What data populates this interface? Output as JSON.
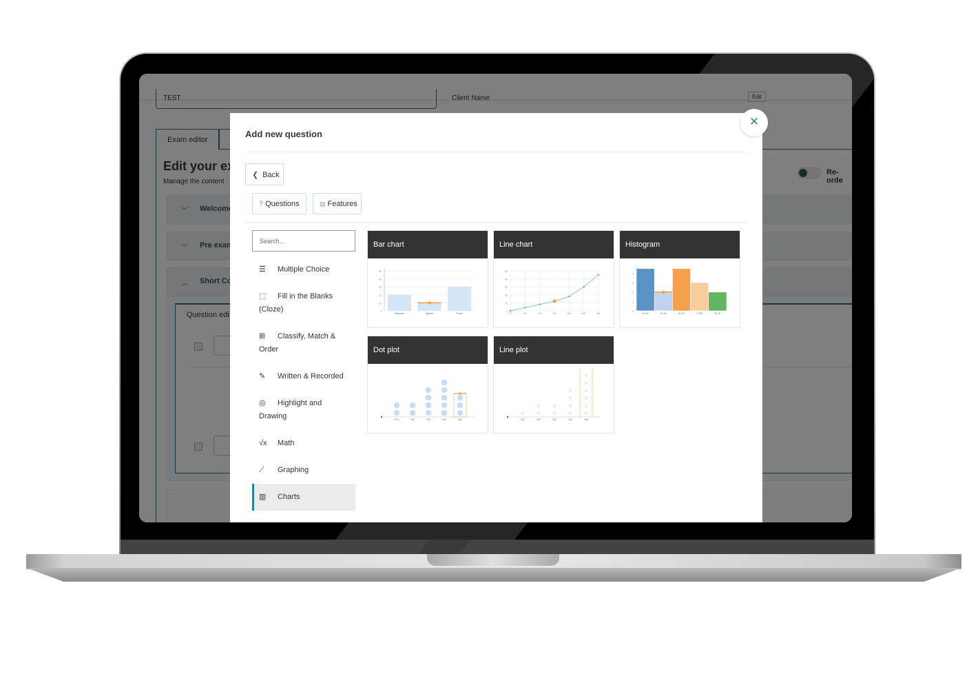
{
  "background_page": {
    "field_value": "TEST",
    "client_label": "Client Name",
    "edit_label": "Edit",
    "tab": "Exam editor",
    "heading": "Edit your ex",
    "subheading": "Manage the content",
    "sections": [
      {
        "chevron": "﹀",
        "label": "Welcome"
      },
      {
        "chevron": "﹀",
        "label": "Pre exam"
      },
      {
        "chevron": "︿",
        "label": "Short Co"
      }
    ],
    "question_editor_label": "Question edi",
    "reorder_label": "Re-orde"
  },
  "modal": {
    "title": "Add new question",
    "close_icon": "✕",
    "back_label": "Back",
    "tabs": [
      {
        "icon": "?",
        "label": "Questions"
      },
      {
        "icon": "🖼",
        "label": "Features"
      }
    ],
    "search_placeholder": "Search...",
    "categories": [
      {
        "icon": "list-icon",
        "glyph": "☰",
        "label": "Multiple Choice",
        "active": false
      },
      {
        "icon": "dotted-box-icon",
        "glyph": "⬚",
        "label": "Fill in the Blanks (Cloze)",
        "active": false
      },
      {
        "icon": "grid-icon",
        "glyph": "⊞",
        "label": "Classify, Match & Order",
        "active": false
      },
      {
        "icon": "pencil-icon",
        "glyph": "✎",
        "label": "Written & Recorded",
        "active": false
      },
      {
        "icon": "target-icon",
        "glyph": "◎",
        "label": "Highlight and Drawing",
        "active": false
      },
      {
        "icon": "sqrt-icon",
        "glyph": "√x",
        "label": "Math",
        "active": false
      },
      {
        "icon": "line-graph-icon",
        "glyph": "⟋",
        "label": "Graphing",
        "active": false
      },
      {
        "icon": "bar-chart-icon",
        "glyph": "▥",
        "label": "Charts",
        "active": true
      }
    ],
    "cards": [
      {
        "title": "Bar chart"
      },
      {
        "title": "Line chart"
      },
      {
        "title": "Histogram"
      },
      {
        "title": "Dot plot"
      },
      {
        "title": "Line plot"
      }
    ]
  },
  "previews": {
    "bar_chart": {
      "categories": [
        "Bananas",
        "Apples",
        "Pears"
      ],
      "values": [
        20,
        10,
        30
      ],
      "y_ticks": [
        0,
        10,
        20,
        30,
        40,
        50
      ],
      "highlight_index": 1,
      "bar_color": "#d3e5f7",
      "highlight_color": "#f59a3e"
    },
    "line_chart": {
      "x": [
        "0",
        "1.0",
        "2.0",
        "3.0",
        "4.0",
        "5.0",
        "6.0"
      ],
      "y": [
        0,
        4,
        8,
        12,
        18,
        30,
        45
      ],
      "y_ticks": [
        0,
        10,
        20,
        30,
        40,
        50
      ],
      "highlight_index": 3,
      "line_color": "#8ec1ee",
      "highlight_color": "#f59a3e"
    },
    "histogram": {
      "categories": [
        "41-50",
        "51-60",
        "61-70",
        "71-80",
        "81-90"
      ],
      "values": [
        4.5,
        2,
        4.5,
        3,
        2
      ],
      "y_ticks": [
        0,
        1,
        2,
        3,
        4
      ],
      "colors": [
        "#5b93c7",
        "#c1d3ec",
        "#f6a04c",
        "#f8cc9b",
        "#64b561"
      ],
      "highlight_index": 1,
      "highlight_color": "#f59a3e"
    },
    "dot_plot": {
      "categories": [
        "x10",
        "x20",
        "x30",
        "x40",
        "x50"
      ],
      "counts": [
        2,
        2,
        4,
        5,
        3
      ],
      "highlight_index": 4,
      "dot_color": "#c7ddf5",
      "highlight_color": "#f59a3e"
    },
    "line_plot": {
      "categories": [
        "x10",
        "x20",
        "x30",
        "x40",
        "x50"
      ],
      "counts": [
        1,
        2,
        2,
        4,
        6
      ],
      "highlight_index": 4,
      "mark_color": "#a9cdf0",
      "highlight_color": "#f59a3e"
    }
  }
}
